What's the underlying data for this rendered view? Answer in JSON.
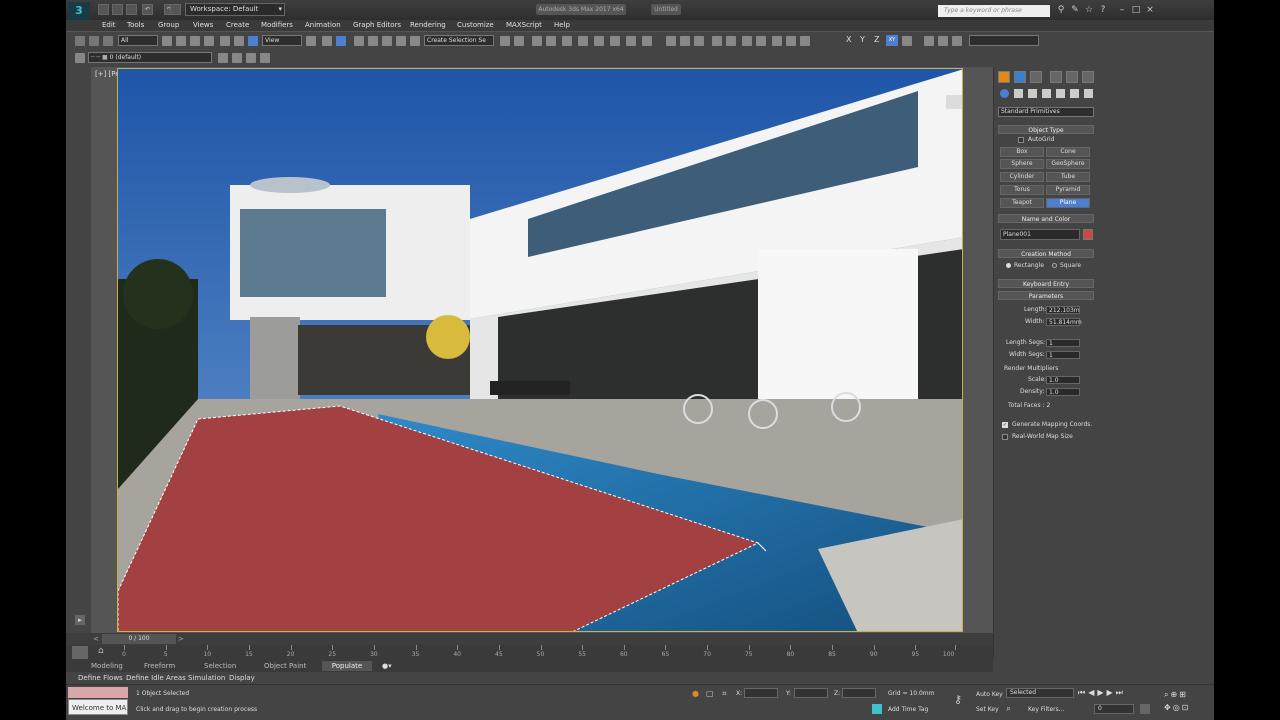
{
  "titlebar": {
    "workspace": "Workspace: Default",
    "app_title": "Autodesk 3ds Max 2017 x64",
    "doc_title": "Untitled",
    "search_placeholder": "Type a keyword or phrase"
  },
  "menu": [
    "Edit",
    "Tools",
    "Group",
    "Views",
    "Create",
    "Modifiers",
    "Animation",
    "Graph Editors",
    "Rendering",
    "Customize",
    "MAXScript",
    "Help"
  ],
  "toolbar": {
    "selection_filter": "All",
    "ref_coord": "View",
    "named_selection": "Create Selection Se",
    "axes": [
      "X",
      "Y",
      "Z",
      "XY"
    ],
    "layer": "0 (default)"
  },
  "viewport": {
    "label": "[+] [Perspective ] [Realistic ]"
  },
  "command_panel": {
    "category": "Standard Primitives",
    "object_type_title": "Object Type",
    "autogrid": "AutoGrid",
    "objects": [
      "Box",
      "Cone",
      "Sphere",
      "GeoSphere",
      "Cylinder",
      "Tube",
      "Torus",
      "Pyramid",
      "Teapot",
      "Plane"
    ],
    "selected_object": "Plane",
    "name_color_title": "Name and Color",
    "object_name": "Plane001",
    "object_color": "#c94848",
    "creation_method_title": "Creation Method",
    "rectangle": "Rectangle",
    "square": "Square",
    "keyboard_entry": "Keyboard Entry",
    "parameters_title": "Parameters",
    "length_label": "Length:",
    "length_value": "212.103m",
    "width_label": "Width:",
    "width_value": "51.814mm",
    "length_segs_label": "Length Segs:",
    "length_segs_value": "1",
    "width_segs_label": "Width Segs:",
    "width_segs_value": "1",
    "render_multipliers": "Render Multipliers",
    "scale_label": "Scale:",
    "scale_value": "1.0",
    "density_label": "Density:",
    "density_value": "1.0",
    "total_faces": "Total Faces : 2",
    "gen_mapping": "Generate Mapping Coords.",
    "real_world": "Real-World Map Size"
  },
  "timeline": {
    "frame_display": "0 / 100",
    "ticks": [
      "0",
      "5",
      "10",
      "15",
      "20",
      "25",
      "30",
      "35",
      "40",
      "45",
      "50",
      "55",
      "60",
      "65",
      "70",
      "75",
      "80",
      "85",
      "90",
      "95",
      "100"
    ]
  },
  "ribbon": {
    "tabs": [
      "Modeling",
      "Freeform",
      "Selection",
      "Object Paint",
      "Populate"
    ],
    "subtabs": [
      "Define Flows",
      "Define Idle Areas",
      "Simulation",
      "Display"
    ]
  },
  "status": {
    "maxscript": "Welcome to MA",
    "selected": "1 Object Selected",
    "prompt": "Click and drag to begin creation process",
    "x_label": "X:",
    "y_label": "Y:",
    "z_label": "Z:",
    "grid": "Grid = 10.0mm",
    "add_time_tag": "Add Time Tag",
    "auto_key": "Auto Key",
    "auto_key_mode": "Selected",
    "set_key": "Set Key",
    "key_filters": "Key Filters...",
    "current_frame": "0"
  },
  "colors": {
    "accent": "#4d7fd1",
    "plane": "#a24042",
    "viewport_border": "#c8b24a"
  }
}
